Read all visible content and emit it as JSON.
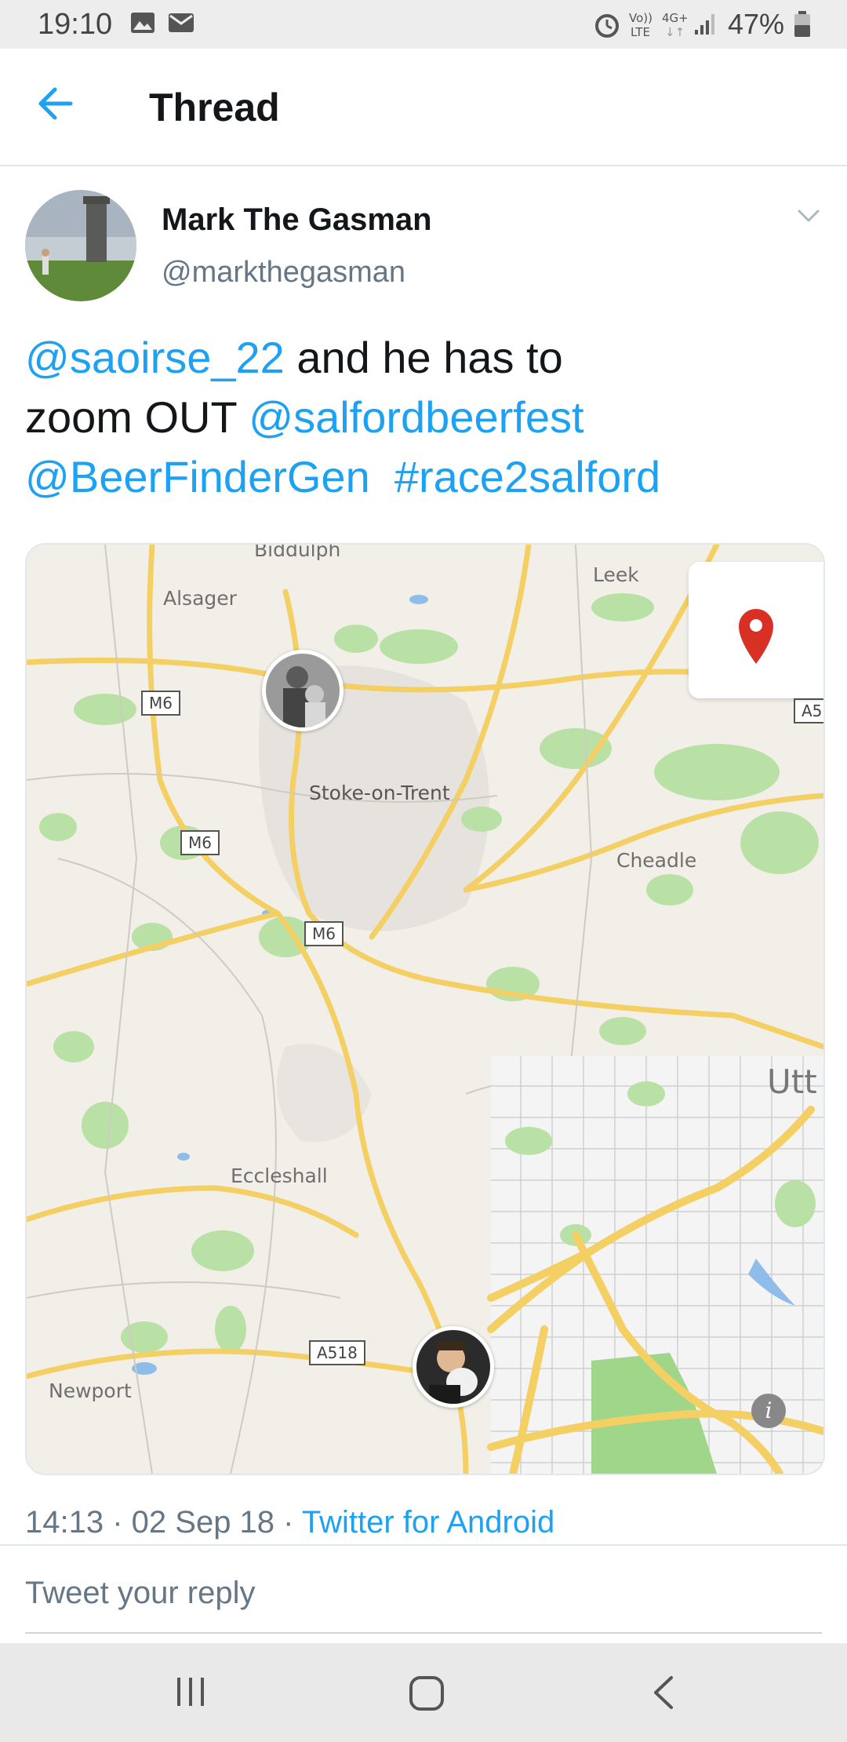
{
  "status_bar": {
    "time": "19:10",
    "battery": "47%",
    "icons": [
      "image-icon",
      "email-icon",
      "alarm-icon",
      "volte-icon",
      "4g-icon",
      "signal-icon",
      "battery-icon"
    ]
  },
  "app_bar": {
    "title": "Thread",
    "back_icon": "arrow-left-icon"
  },
  "tweet": {
    "author_name": "Mark The Gasman",
    "author_handle": "@markthegasman",
    "text_parts": {
      "mention1": "@saoirse_22",
      "plain1": " and he has to",
      "plain2": "zoom OUT ",
      "mention2": "@salfordbeerfest",
      "mention3": "@BeerFinderGen",
      "hashtag": "#race2salford"
    },
    "time": "14:13",
    "date": "02 Sep 18",
    "separator": " · ",
    "client": "Twitter for Android"
  },
  "map": {
    "places": {
      "biddulph": "Biddulph",
      "leek": "Leek",
      "alsager": "Alsager",
      "stoke": "Stoke-on-Trent",
      "cheadle": "Cheadle",
      "eccleshall": "Eccleshall",
      "newport": "Newport",
      "utt": "Utt"
    },
    "roads": {
      "m6_a": "M6",
      "m6_b": "M6",
      "m6_c": "M6",
      "a518": "A518",
      "a5": "A5"
    },
    "pin_icon": "location-pin-icon",
    "info_icon": "i",
    "colors": {
      "road": "#f7d46b",
      "green": "#b5dfa0",
      "water": "#8dbde8",
      "land": "#f2efe9"
    }
  },
  "reply": {
    "placeholder": "Tweet your reply"
  },
  "nav_bar": {
    "icons": [
      "recents-icon",
      "home-icon",
      "back-icon"
    ]
  },
  "colors": {
    "accent": "#1da1f2",
    "secondary_text": "#657786",
    "pin": "#d93025"
  }
}
